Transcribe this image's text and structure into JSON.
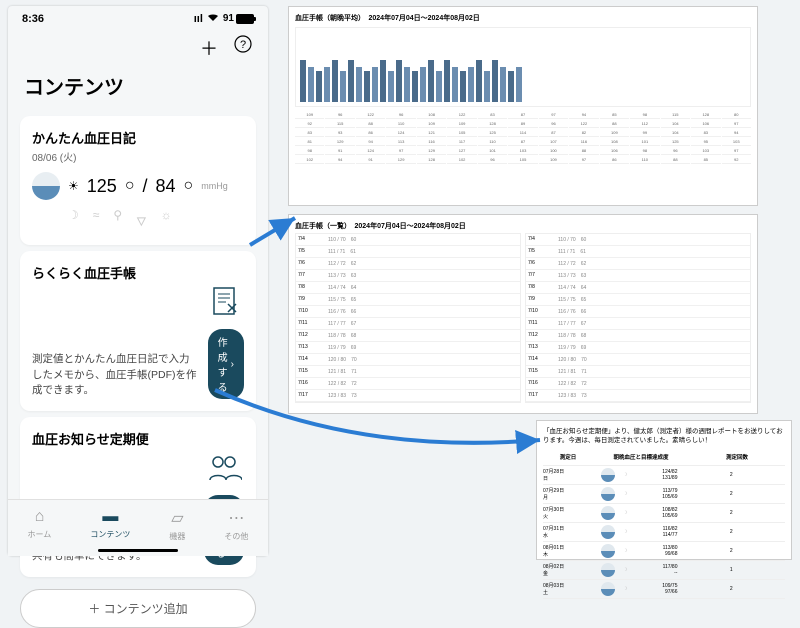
{
  "status": {
    "time": "8:36",
    "battery": "91"
  },
  "header": {
    "title": "コンテンツ"
  },
  "diary": {
    "title": "かんたん血圧日記",
    "date": "08/06 (火)",
    "sys": "125",
    "dia": "84",
    "unit": "mmHg"
  },
  "notebook": {
    "title": "らくらく血圧手帳",
    "desc": "測定値とかんたん血圧日記で入力したメモから、血圧手帳(PDF)を作成できます。",
    "button": "作成する"
  },
  "mail": {
    "title": "血圧お知らせ定期便",
    "desc": "毎週メールでレポートをお届け。共有も簡単にできます。",
    "button": "設定する"
  },
  "add": "＋ コンテンツ追加",
  "tabs": [
    {
      "label": "ホーム"
    },
    {
      "label": "コンテンツ"
    },
    {
      "label": "機器"
    },
    {
      "label": "その他"
    }
  ],
  "report1": {
    "title": "血圧手帳（朝晩平均）",
    "range": "2024年07月04日～2024年08月02日"
  },
  "report2": {
    "title": "血圧手帳（一覧）",
    "range": "2024年07月04日～2024年08月02日"
  },
  "report3": {
    "intro": "「血圧お知らせ定期便」より、健太郎（測定者）様の週間レポートをお送りしております。今週は、毎日測定されていました。素晴らしい！",
    "cols": [
      "測定日",
      "朝晩血圧と目標達成度",
      "測定回数"
    ],
    "rows": [
      {
        "date": "07月28日\n日",
        "bp": "124/82\n131/89",
        "cnt": "2"
      },
      {
        "date": "07月29日\n月",
        "bp": "113/79\n105/69",
        "cnt": "2"
      },
      {
        "date": "07月30日\n火",
        "bp": "108/82\n105/69",
        "cnt": "2"
      },
      {
        "date": "07月31日\n水",
        "bp": "116/82\n114/77",
        "cnt": "2"
      },
      {
        "date": "08月01日\n木",
        "bp": "113/80\n99/68",
        "cnt": "2"
      },
      {
        "date": "08月02日\n金",
        "bp": "117/80\n--",
        "cnt": "1"
      },
      {
        "date": "08月03日\n土",
        "bp": "109/75\n97/66",
        "cnt": "2"
      }
    ]
  }
}
